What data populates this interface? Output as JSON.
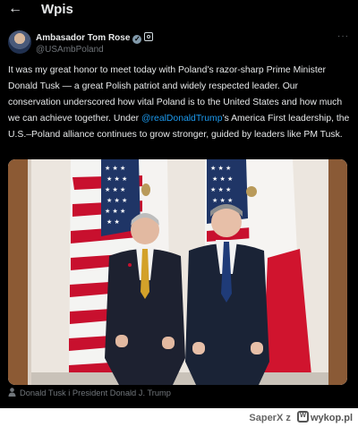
{
  "header": {
    "back_icon": "arrow-left-icon",
    "title": "Wpis"
  },
  "author": {
    "name": "Ambasador Tom Rose",
    "handle": "@USAmbPoland",
    "verified_icon": "verified-badge-icon",
    "gov_icon": "government-badge-icon"
  },
  "more_label": "···",
  "tweet": {
    "text_before": "It was my great honor to meet today with Poland’s razor-sharp Prime Minister Donald Tusk — a great Polish patriot and widely respected leader. Our conservation underscored how vital Poland is to the United States and how much we can achieve together. Under ",
    "mention": "@realDonaldTrump",
    "text_after": "’s America First leadership, the U.S.–Poland alliance continues to grow stronger, guided by leaders like PM Tusk."
  },
  "photo": {
    "description_icon": "photo-icon",
    "caption": "Donald Tusk i President Donald J. Trump"
  },
  "footer": {
    "user": "SaperX",
    "connector": "z",
    "site": "wykop.pl"
  },
  "colors": {
    "background": "#000000",
    "text": "#e7e9ea",
    "muted": "#71767b",
    "link": "#1d9bf0"
  }
}
